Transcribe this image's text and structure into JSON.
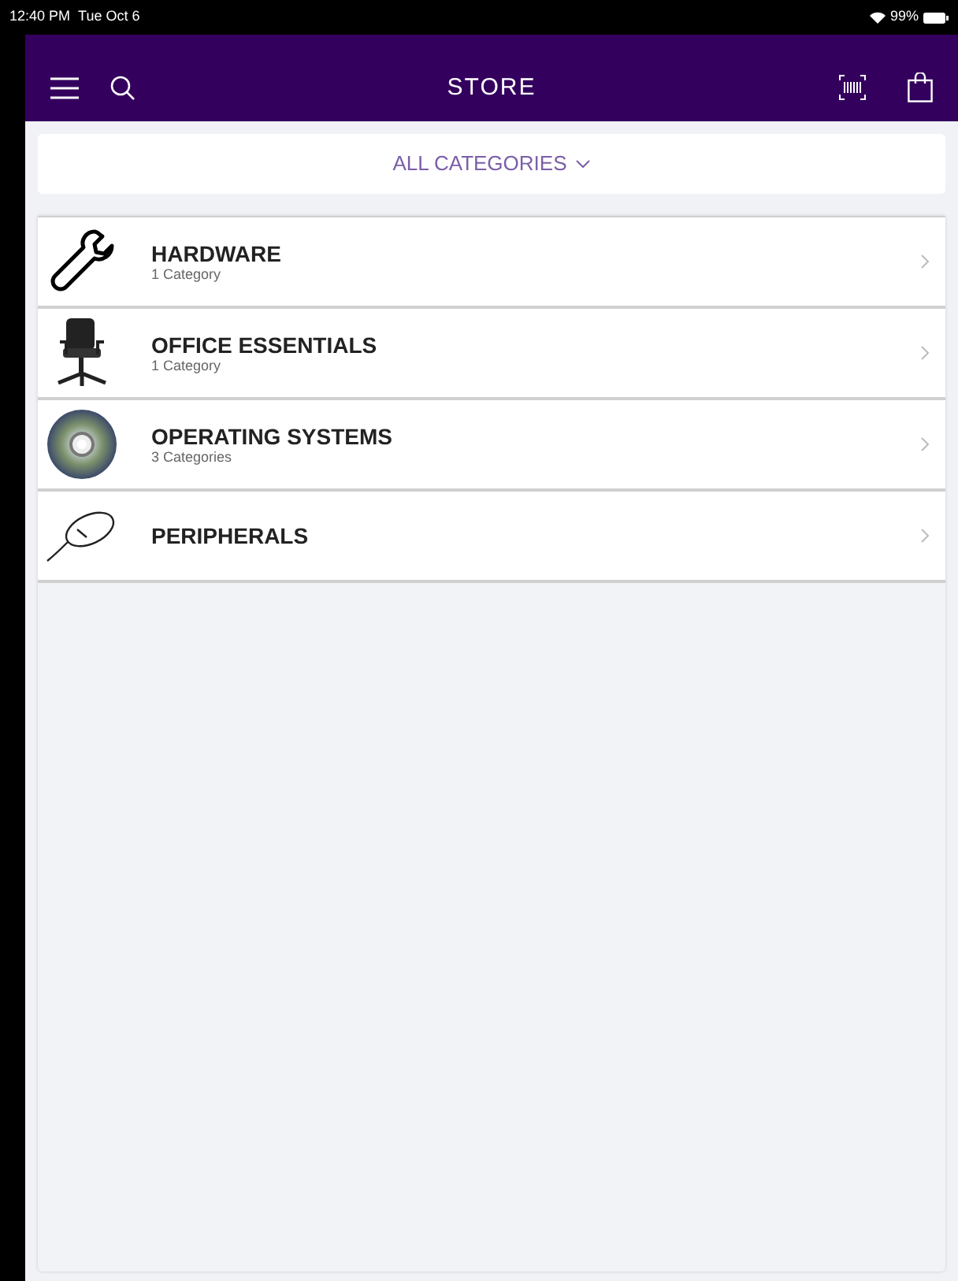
{
  "status_bar": {
    "time": "12:40 PM",
    "date": "Tue Oct 6",
    "battery": "99%"
  },
  "header": {
    "title": "STORE"
  },
  "category_filter": {
    "label": "ALL CATEGORIES"
  },
  "categories": [
    {
      "kind": "wrench",
      "title": "HARDWARE",
      "subtitle": "1 Category"
    },
    {
      "kind": "chair",
      "title": "OFFICE ESSENTIALS",
      "subtitle": "1 Category"
    },
    {
      "kind": "disc",
      "title": "OPERATING SYSTEMS",
      "subtitle": "3 Categories"
    },
    {
      "kind": "mouse",
      "title": "PERIPHERALS"
    }
  ]
}
